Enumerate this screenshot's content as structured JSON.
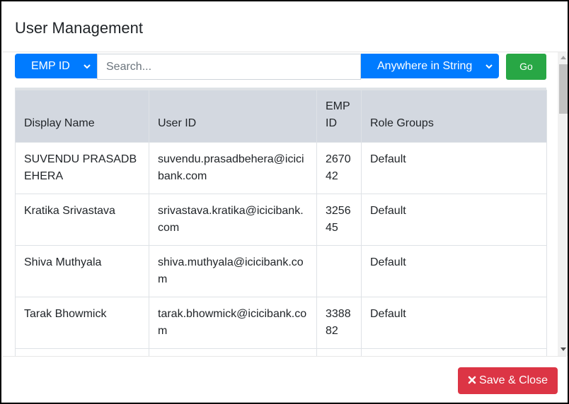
{
  "modal": {
    "title": "User Management"
  },
  "search": {
    "field_selected": "EMP ID",
    "placeholder": "Search...",
    "value": "",
    "match_selected": "Anywhere in String",
    "go_label": "Go"
  },
  "table": {
    "headers": [
      "Display Name",
      "User ID",
      "EMP ID",
      "Role Groups"
    ],
    "rows": [
      [
        "SUVENDU PRASADBEHERA",
        "suvendu.prasadbehera@icicibank.com",
        "267042",
        "Default"
      ],
      [
        "Kratika Srivastava",
        "srivastava.kratika@icicibank.com",
        "325645",
        "Default"
      ],
      [
        "Shiva Muthyala",
        "shiva.muthyala@icicibank.com",
        "",
        "Default"
      ],
      [
        "Tarak Bhowmick",
        "tarak.bhowmick@icicibank.com",
        "338882",
        "Default"
      ]
    ]
  },
  "footer": {
    "save_label": "Save & Close",
    "save_icon": "close-x-icon"
  },
  "colors": {
    "primary": "#007bff",
    "success": "#28a745",
    "danger": "#dc3545",
    "table_header_bg": "#d3d8e0"
  }
}
